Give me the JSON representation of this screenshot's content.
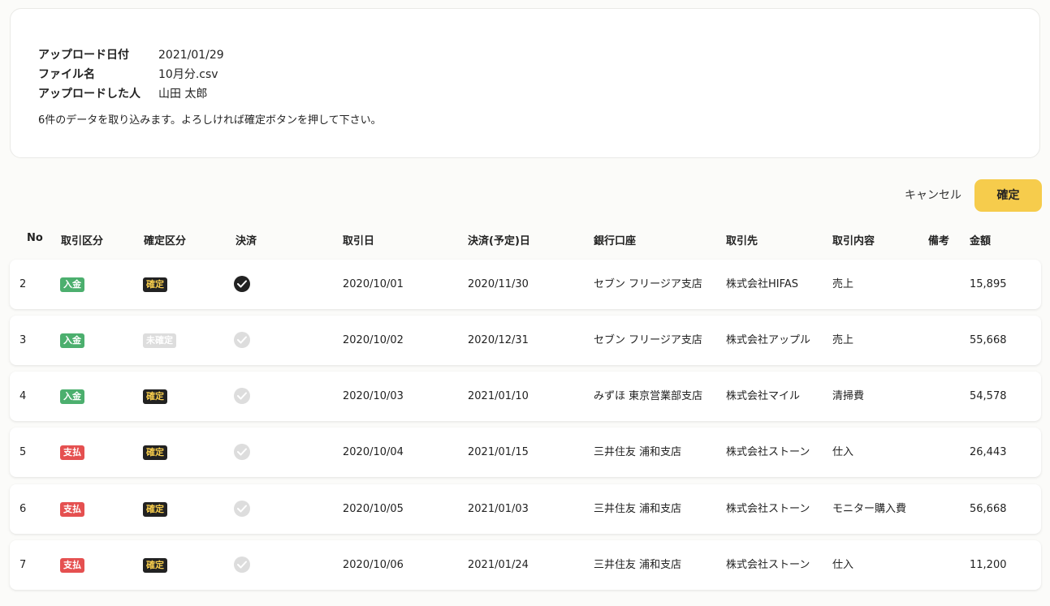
{
  "upload_info": {
    "date_label": "アップロード日付",
    "date_value": "2021/01/29",
    "file_label": "ファイル名",
    "file_value": "10月分.csv",
    "uploader_label": "アップロードした人",
    "uploader_value": "山田 太郎",
    "note": "6件のデータを取り込みます。よろしければ確定ボタンを押して下さい。"
  },
  "actions": {
    "cancel_label": "キャンセル",
    "confirm_label": "確定"
  },
  "table": {
    "headers": {
      "no": "No",
      "type": "取引区分",
      "status": "確定区分",
      "settled": "決済",
      "date": "取引日",
      "due_date": "決済(予定)日",
      "account": "銀行口座",
      "partner": "取引先",
      "content": "取引内容",
      "memo": "備考",
      "amount": "金額"
    },
    "rows": [
      {
        "no": "2",
        "type": "入金",
        "type_kind": "deposit",
        "status": "確定",
        "status_kind": "fixed",
        "settled": true,
        "date": "2020/10/01",
        "due_date": "2020/11/30",
        "account": "セブン フリージア支店",
        "partner": "株式会社HIFAS",
        "content": "売上",
        "memo": "",
        "amount": "15,895"
      },
      {
        "no": "3",
        "type": "入金",
        "type_kind": "deposit",
        "status": "未確定",
        "status_kind": "unfixed",
        "settled": false,
        "date": "2020/10/02",
        "due_date": "2020/12/31",
        "account": "セブン フリージア支店",
        "partner": "株式会社アップル",
        "content": "売上",
        "memo": "",
        "amount": "55,668"
      },
      {
        "no": "4",
        "type": "入金",
        "type_kind": "deposit",
        "status": "確定",
        "status_kind": "fixed",
        "settled": false,
        "date": "2020/10/03",
        "due_date": "2021/01/10",
        "account": "みずほ 東京営業部支店",
        "partner": "株式会社マイル",
        "content": "清掃費",
        "memo": "",
        "amount": "54,578"
      },
      {
        "no": "5",
        "type": "支払",
        "type_kind": "payment",
        "status": "確定",
        "status_kind": "fixed",
        "settled": false,
        "date": "2020/10/04",
        "due_date": "2021/01/15",
        "account": "三井住友 浦和支店",
        "partner": "株式会社ストーン",
        "content": "仕入",
        "memo": "",
        "amount": "26,443"
      },
      {
        "no": "6",
        "type": "支払",
        "type_kind": "payment",
        "status": "確定",
        "status_kind": "fixed",
        "settled": false,
        "date": "2020/10/05",
        "due_date": "2021/01/03",
        "account": "三井住友 浦和支店",
        "partner": "株式会社ストーン",
        "content": "モニター購入費",
        "memo": "",
        "amount": "56,668"
      },
      {
        "no": "7",
        "type": "支払",
        "type_kind": "payment",
        "status": "確定",
        "status_kind": "fixed",
        "settled": false,
        "date": "2020/10/06",
        "due_date": "2021/01/24",
        "account": "三井住友 浦和支店",
        "partner": "株式会社ストーン",
        "content": "仕入",
        "memo": "",
        "amount": "11,200"
      }
    ]
  }
}
